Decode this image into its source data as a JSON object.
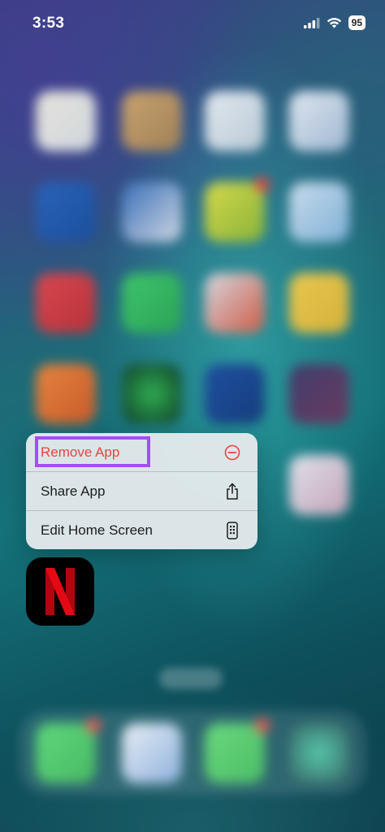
{
  "status_bar": {
    "time": "3:53",
    "battery": "95"
  },
  "context_menu": {
    "items": [
      {
        "label": "Remove App",
        "icon": "minus-circle-icon",
        "color": "#e8453c"
      },
      {
        "label": "Share App",
        "icon": "share-icon"
      },
      {
        "label": "Edit Home Screen",
        "icon": "phone-edit-icon"
      }
    ]
  },
  "focused_app": {
    "name": "Netflix",
    "icon": "netflix-logo",
    "color": "#e50914"
  },
  "annotation": {
    "highlight_color": "#a84cf0"
  }
}
